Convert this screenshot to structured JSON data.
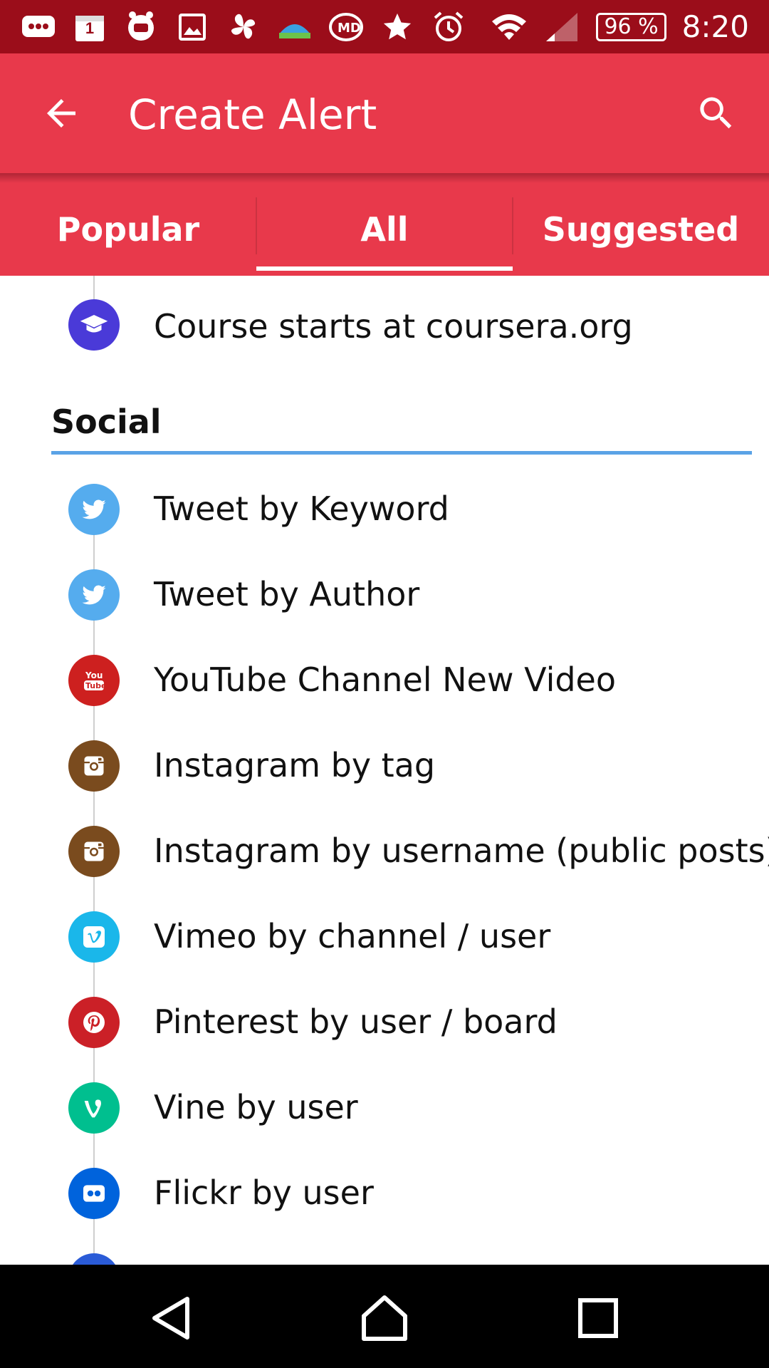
{
  "status_bar": {
    "icons": [
      "chat-notification-icon",
      "calendar-icon",
      "app-notification-icon",
      "image-icon",
      "pinwheel-icon",
      "weather-icon",
      "md-app-icon",
      "star-icon",
      "alarm-icon",
      "wifi-icon",
      "signal-icon"
    ],
    "calendar_day": "1",
    "battery": "96 %",
    "time": "8:20"
  },
  "app_bar": {
    "title": "Create Alert",
    "back_icon": "arrow-back-icon",
    "search_icon": "search-icon",
    "color": "#e8394b"
  },
  "tabs": [
    {
      "label": "Popular",
      "selected": false
    },
    {
      "label": "All",
      "selected": true
    },
    {
      "label": "Suggested",
      "selected": false
    }
  ],
  "list": {
    "partial_item": {
      "label": "Course starts at coursera.org",
      "icon": "graduation-cap-icon",
      "color": "#4a3ad8"
    },
    "section": {
      "title": "Social",
      "rule_color": "#5aa3e6"
    },
    "items": [
      {
        "label": "Tweet by Keyword",
        "icon": "twitter-icon",
        "color": "#55acee"
      },
      {
        "label": "Tweet by Author",
        "icon": "twitter-icon",
        "color": "#55acee"
      },
      {
        "label": "YouTube Channel New Video",
        "icon": "youtube-icon",
        "color": "#cd201f"
      },
      {
        "label": "Instagram by tag",
        "icon": "instagram-icon",
        "color": "#7a4b1e"
      },
      {
        "label": "Instagram by username (public posts)",
        "icon": "instagram-icon",
        "color": "#7a4b1e"
      },
      {
        "label": "Vimeo by channel / user",
        "icon": "vimeo-icon",
        "color": "#1ab7ea"
      },
      {
        "label": "Pinterest by user / board",
        "icon": "pinterest-icon",
        "color": "#cb2027"
      },
      {
        "label": "Vine by user",
        "icon": "vine-icon",
        "color": "#00bf8f"
      },
      {
        "label": "Flickr by user",
        "icon": "flickr-icon",
        "color": "#0063dc"
      }
    ]
  },
  "nav_bar": {
    "back": "nav-back-icon",
    "home": "nav-home-icon",
    "recents": "nav-recents-icon"
  }
}
